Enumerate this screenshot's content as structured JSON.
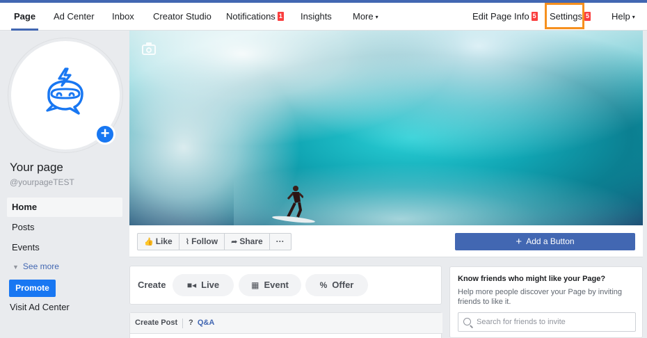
{
  "nav": {
    "items": [
      {
        "label": "Page",
        "badge": "",
        "caret": ""
      },
      {
        "label": "Ad Center",
        "badge": "",
        "caret": ""
      },
      {
        "label": "Inbox",
        "badge": "",
        "caret": ""
      },
      {
        "label": "Creator Studio",
        "badge": "",
        "caret": ""
      },
      {
        "label": "Notifications",
        "badge": "1",
        "caret": ""
      },
      {
        "label": "Insights",
        "badge": "",
        "caret": ""
      },
      {
        "label": "More",
        "badge": "",
        "caret": "▾"
      },
      {
        "label": "Edit Page Info",
        "badge": "5",
        "caret": ""
      },
      {
        "label": "Settings",
        "badge": "5",
        "caret": ""
      },
      {
        "label": "Help",
        "badge": "",
        "caret": "▾"
      }
    ]
  },
  "profile": {
    "name": "Your page",
    "handle": "@yourpageTEST"
  },
  "sidebar": {
    "items": [
      "Home",
      "Posts",
      "Events"
    ],
    "see_more": "See more",
    "promote": "Promote",
    "visit_ad_center": "Visit Ad Center"
  },
  "actions": {
    "like": "Like",
    "follow": "Follow",
    "share": "Share",
    "more": "···",
    "add_button": "Add a Button"
  },
  "create": {
    "label": "Create",
    "live": "Live",
    "event": "Event",
    "offer": "Offer"
  },
  "post": {
    "create_post": "Create Post",
    "qa_icon": "?",
    "qa": "Q&A"
  },
  "invite": {
    "title": "Know friends who might like your Page?",
    "description": "Help more people discover your Page by inviting friends to like it.",
    "search_placeholder": "Search for friends to invite"
  },
  "colors": {
    "accent": "#4267b2",
    "primary_button": "#1877f2",
    "badge": "#fa3e3e",
    "highlight": "#f6901e"
  }
}
